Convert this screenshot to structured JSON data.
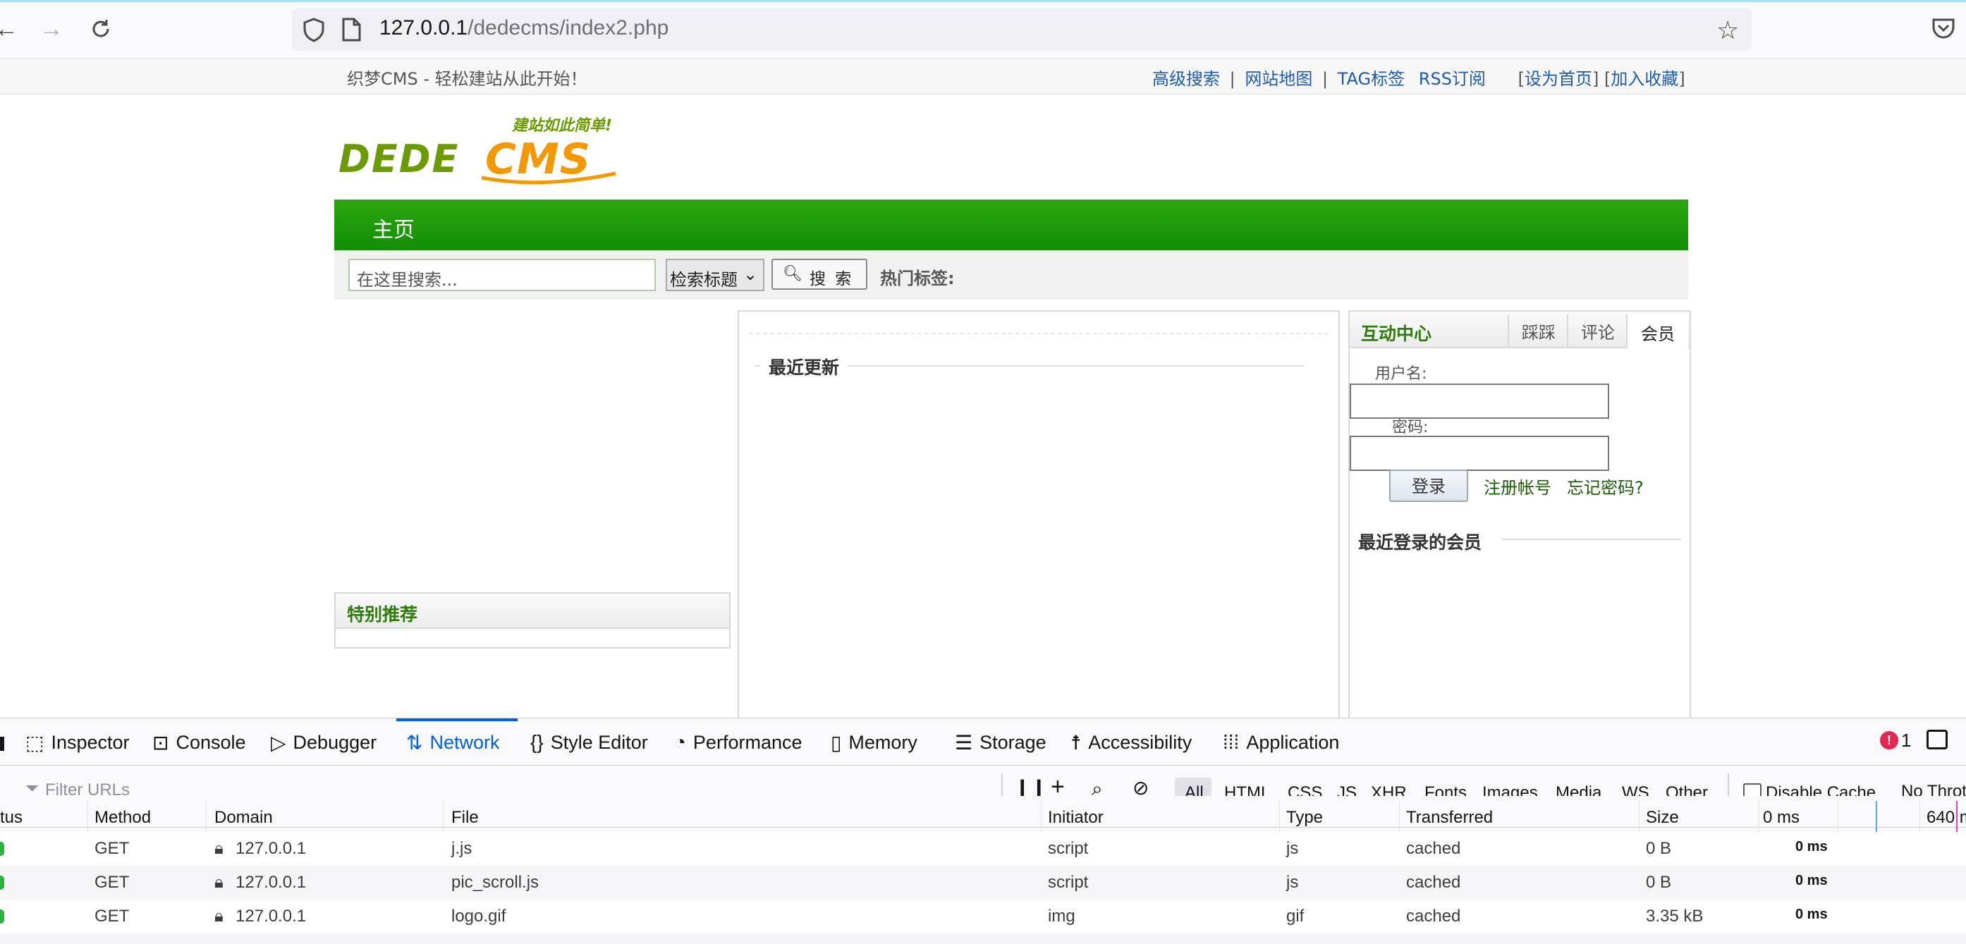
{
  "browser": {
    "url_host": "127.0.0.1",
    "url_path": "/dedecms/index2.php"
  },
  "site": {
    "tagline": "织梦CMS - 轻松建站从此开始！",
    "top_links": [
      "高级搜索",
      "网站地图",
      "TAG标签",
      "RSS订阅"
    ],
    "set_home": "设为首页",
    "add_fav": "加入收藏",
    "logo_text": "DEDECMS",
    "logo_slogan": "建站如此简单!",
    "nav_home": "主页",
    "search_placeholder": "在这里搜索...",
    "search_select": "检索标题",
    "search_button": "搜 索",
    "hot_tags_label": "热门标签:",
    "special_recommend": "特别推荐",
    "recent_updates": "最近更新",
    "interaction_center": "互动中心",
    "tabs": [
      "踩踩",
      "评论",
      "会员"
    ],
    "username_label": "用户名:",
    "password_label": "密码:",
    "login_button": "登录",
    "register_link": "注册帐号",
    "forgot_link": "忘记密码?",
    "recent_members": "最近登录的会员"
  },
  "devtools": {
    "tabs": [
      "Inspector",
      "Console",
      "Debugger",
      "Network",
      "Style Editor",
      "Performance",
      "Memory",
      "Storage",
      "Accessibility",
      "Application"
    ],
    "active_tab": "Network",
    "error_count": "1",
    "filter_placeholder": "Filter URLs",
    "filter_types": [
      "All",
      "HTML",
      "CSS",
      "JS",
      "XHR",
      "Fonts",
      "Images",
      "Media",
      "WS",
      "Other"
    ],
    "disable_cache": "Disable Cache",
    "throttle": "No Throt",
    "columns": [
      "tus",
      "Method",
      "Domain",
      "File",
      "Initiator",
      "Type",
      "Transferred",
      "Size",
      "0 ms",
      "640 m"
    ],
    "rows": [
      {
        "method": "GET",
        "domain": "127.0.0.1",
        "file": "j.js",
        "initiator": "script",
        "type": "js",
        "transferred": "cached",
        "size": "0 B",
        "time": "0 ms"
      },
      {
        "method": "GET",
        "domain": "127.0.0.1",
        "file": "pic_scroll.js",
        "initiator": "script",
        "type": "js",
        "transferred": "cached",
        "size": "0 B",
        "time": "0 ms"
      },
      {
        "method": "GET",
        "domain": "127.0.0.1",
        "file": "logo.gif",
        "initiator": "img",
        "type": "gif",
        "transferred": "cached",
        "size": "3.35 kB",
        "time": "0 ms"
      }
    ]
  },
  "colors": {
    "nav_green": "#1a950a",
    "logo_green": "#6a9b00",
    "logo_orange": "#f39800",
    "link_blue": "#1c5bb0",
    "devtools_active": "#0061e0"
  }
}
